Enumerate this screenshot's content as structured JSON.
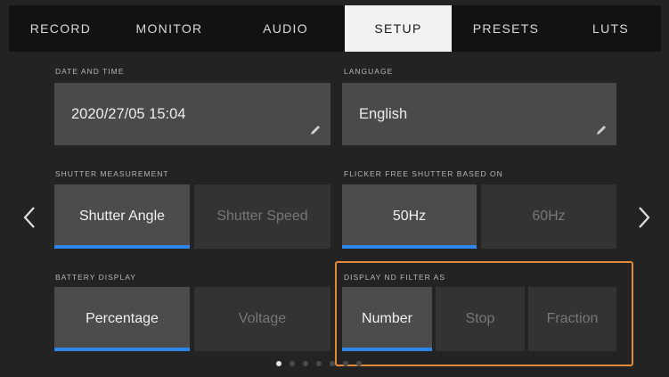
{
  "tabs": [
    {
      "label": "RECORD"
    },
    {
      "label": "MONITOR"
    },
    {
      "label": "AUDIO"
    },
    {
      "label": "SETUP",
      "active": true
    },
    {
      "label": "PRESETS"
    },
    {
      "label": "LUTS"
    }
  ],
  "date_time": {
    "label": "DATE AND TIME",
    "value": "2020/27/05 15:04"
  },
  "language": {
    "label": "LANGUAGE",
    "value": "English"
  },
  "shutter_measurement": {
    "label": "SHUTTER MEASUREMENT",
    "options": [
      "Shutter Angle",
      "Shutter Speed"
    ],
    "selected": "Shutter Angle"
  },
  "flicker_free": {
    "label": "FLICKER FREE SHUTTER BASED ON",
    "options": [
      "50Hz",
      "60Hz"
    ],
    "selected": "50Hz"
  },
  "battery_display": {
    "label": "BATTERY DISPLAY",
    "options": [
      "Percentage",
      "Voltage"
    ],
    "selected": "Percentage"
  },
  "nd_filter": {
    "label": "DISPLAY ND FILTER AS",
    "options": [
      "Number",
      "Stop",
      "Fraction"
    ],
    "selected": "Number"
  },
  "pagination": {
    "total": 7,
    "current": 1
  },
  "colors": {
    "accent": "#2f86e8",
    "highlight": "#e08a3a",
    "tab_active_bg": "#f2f2f2"
  }
}
